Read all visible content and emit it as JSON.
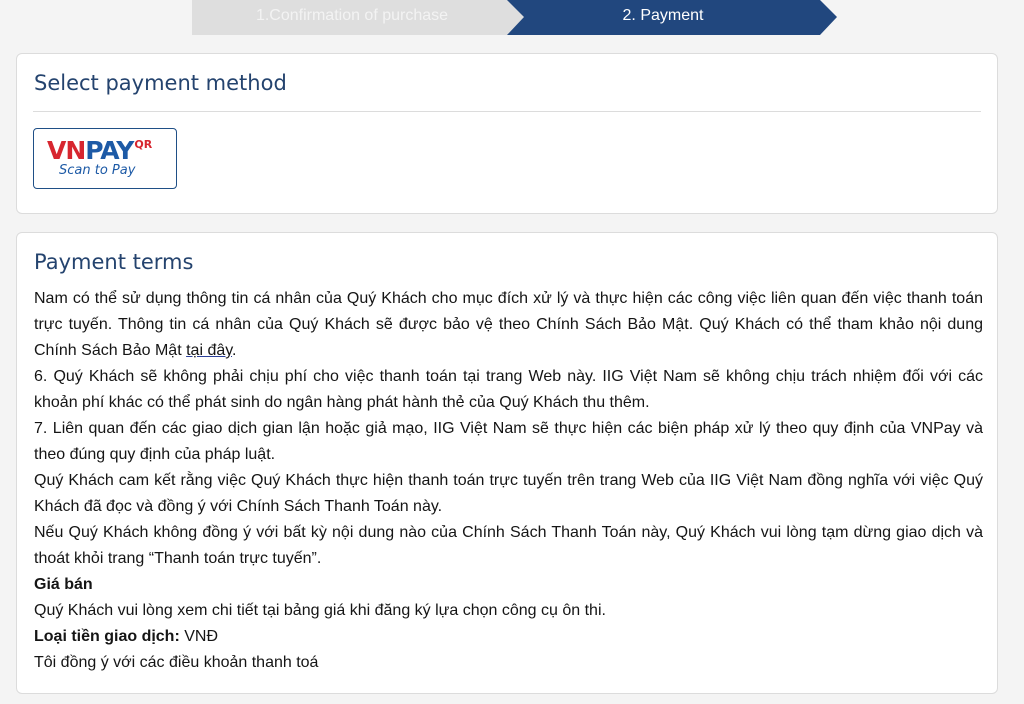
{
  "stepper": {
    "steps": [
      {
        "label": "1.Confirmation of purchase",
        "state": "inactive"
      },
      {
        "label": "2. Payment",
        "state": "active"
      }
    ],
    "colors": {
      "inactive": "#dedede",
      "active": "#21477e"
    }
  },
  "payment_method": {
    "title": "Select payment method",
    "option": {
      "logo_vn": "VN",
      "logo_pay": "PAY",
      "logo_qr": "QR",
      "subtitle": "Scan to Pay"
    }
  },
  "terms": {
    "title": "Payment terms",
    "p1_before_link": "Nam có thể sử dụng thông tin cá nhân của Quý Khách cho mục đích xử lý và thực hiện các công việc liên quan đến việc thanh toán trực tuyến. Thông tin cá nhân của Quý Khách sẽ được bảo vệ theo Chính Sách Bảo Mật. Quý Khách có thể tham khảo nội dung Chính Sách Bảo Mật ",
    "p1_link": "tại đây",
    "p1_after_link": ".",
    "p2": "6. Quý Khách sẽ không phải chịu phí cho việc thanh toán tại trang Web này. IIG Việt Nam sẽ không chịu trách nhiệm đối với các khoản phí khác có thể phát sinh do ngân hàng phát hành thẻ của Quý Khách thu thêm.",
    "p3": "7. Liên quan đến các giao dịch gian lận hoặc giả mạo, IIG Việt Nam sẽ thực hiện các biện pháp xử lý theo quy định của VNPay và theo đúng quy định của pháp luật.",
    "p4": "Quý Khách cam kết rằng việc Quý Khách thực hiện thanh toán trực tuyến trên trang Web của IIG Việt Nam đồng nghĩa với việc Quý Khách đã đọc và đồng ý với Chính Sách Thanh Toán này.",
    "p5": "Nếu Quý Khách không đồng ý với bất kỳ nội dung nào của Chính Sách Thanh Toán này, Quý Khách vui lòng tạm dừng giao dịch và thoát khỏi trang “Thanh toán trực tuyến”.",
    "price_heading": "Giá bán",
    "price_text": "Quý Khách vui lòng xem chi tiết tại bảng giá khi đăng ký lựa chọn công cụ ôn thi.",
    "currency_label": "Loại tiền giao dịch:",
    "currency_value": " VNĐ",
    "agree_text": "Tôi đồng ý với các điều khoản thanh toá"
  }
}
